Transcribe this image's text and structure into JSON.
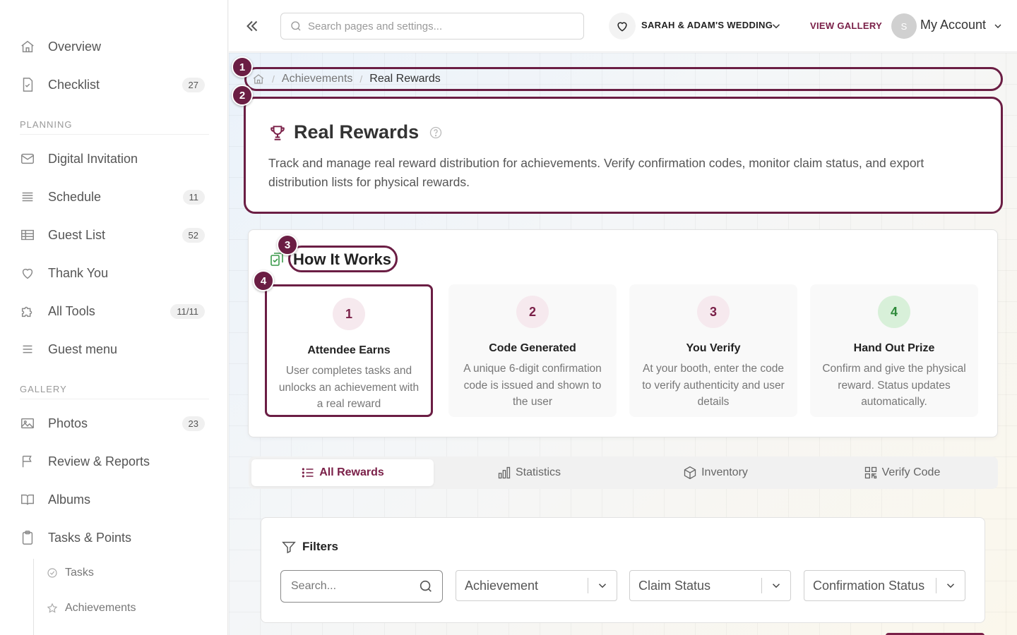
{
  "sidebar": {
    "items": [
      {
        "label": "Overview",
        "badge": "",
        "icon": "home-icon"
      },
      {
        "label": "Checklist",
        "badge": "27",
        "icon": "checklist-icon"
      },
      {
        "label": "Digital Invitation",
        "badge": "",
        "icon": "envelope-icon"
      },
      {
        "label": "Schedule",
        "badge": "11",
        "icon": "schedule-icon"
      },
      {
        "label": "Guest List",
        "badge": "52",
        "icon": "table-icon"
      },
      {
        "label": "Thank You",
        "badge": "",
        "icon": "heart-icon"
      },
      {
        "label": "All Tools",
        "badge": "11/11",
        "icon": "puzzle-icon"
      },
      {
        "label": "Guest menu",
        "badge": "",
        "icon": "menu-icon"
      },
      {
        "label": "Photos",
        "badge": "23",
        "icon": "image-icon"
      },
      {
        "label": "Review & Reports",
        "badge": "",
        "icon": "flag-icon"
      },
      {
        "label": "Albums",
        "badge": "",
        "icon": "book-icon"
      },
      {
        "label": "Tasks & Points",
        "badge": "",
        "icon": "clipboard-icon"
      }
    ],
    "sections": {
      "planning": "PLANNING",
      "gallery": "GALLERY"
    },
    "sub_items": [
      {
        "label": "Tasks",
        "icon": "check-circle-icon"
      },
      {
        "label": "Achievements",
        "icon": "star-icon"
      }
    ]
  },
  "topbar": {
    "search_placeholder": "Search pages and settings...",
    "event_name": "SARAH & ADAM'S WEDDING",
    "view_gallery": "VIEW GALLERY",
    "avatar_initial": "S",
    "account_label": "My Account"
  },
  "breadcrumb": {
    "items": [
      "Achievements",
      "Real Rewards"
    ]
  },
  "header": {
    "title": "Real Rewards",
    "description": "Track and manage real reward distribution for achievements. Verify confirmation codes, monitor claim status, and export distribution lists for physical rewards."
  },
  "how_it_works": {
    "title": "How It Works",
    "steps": [
      {
        "num": "1",
        "title": "Attendee Earns",
        "desc": "User completes tasks and unlocks an achievement with a real reward"
      },
      {
        "num": "2",
        "title": "Code Generated",
        "desc": "A unique 6-digit confirmation code is issued and shown to the user"
      },
      {
        "num": "3",
        "title": "You Verify",
        "desc": "At your booth, enter the code to verify authenticity and user details"
      },
      {
        "num": "4",
        "title": "Hand Out Prize",
        "desc": "Confirm and give the physical reward. Status updates automatically."
      }
    ]
  },
  "tabs": [
    {
      "label": "All Rewards",
      "active": true
    },
    {
      "label": "Statistics",
      "active": false
    },
    {
      "label": "Inventory",
      "active": false
    },
    {
      "label": "Verify Code",
      "active": false
    }
  ],
  "filters": {
    "title": "Filters",
    "search_placeholder": "Search...",
    "selects": [
      "Achievement",
      "Claim Status",
      "Confirmation Status"
    ]
  },
  "markers": [
    "1",
    "2",
    "3",
    "4"
  ],
  "colors": {
    "accent": "#6b1e44",
    "brand_text": "#7a2048",
    "success": "#3a9a4a"
  }
}
